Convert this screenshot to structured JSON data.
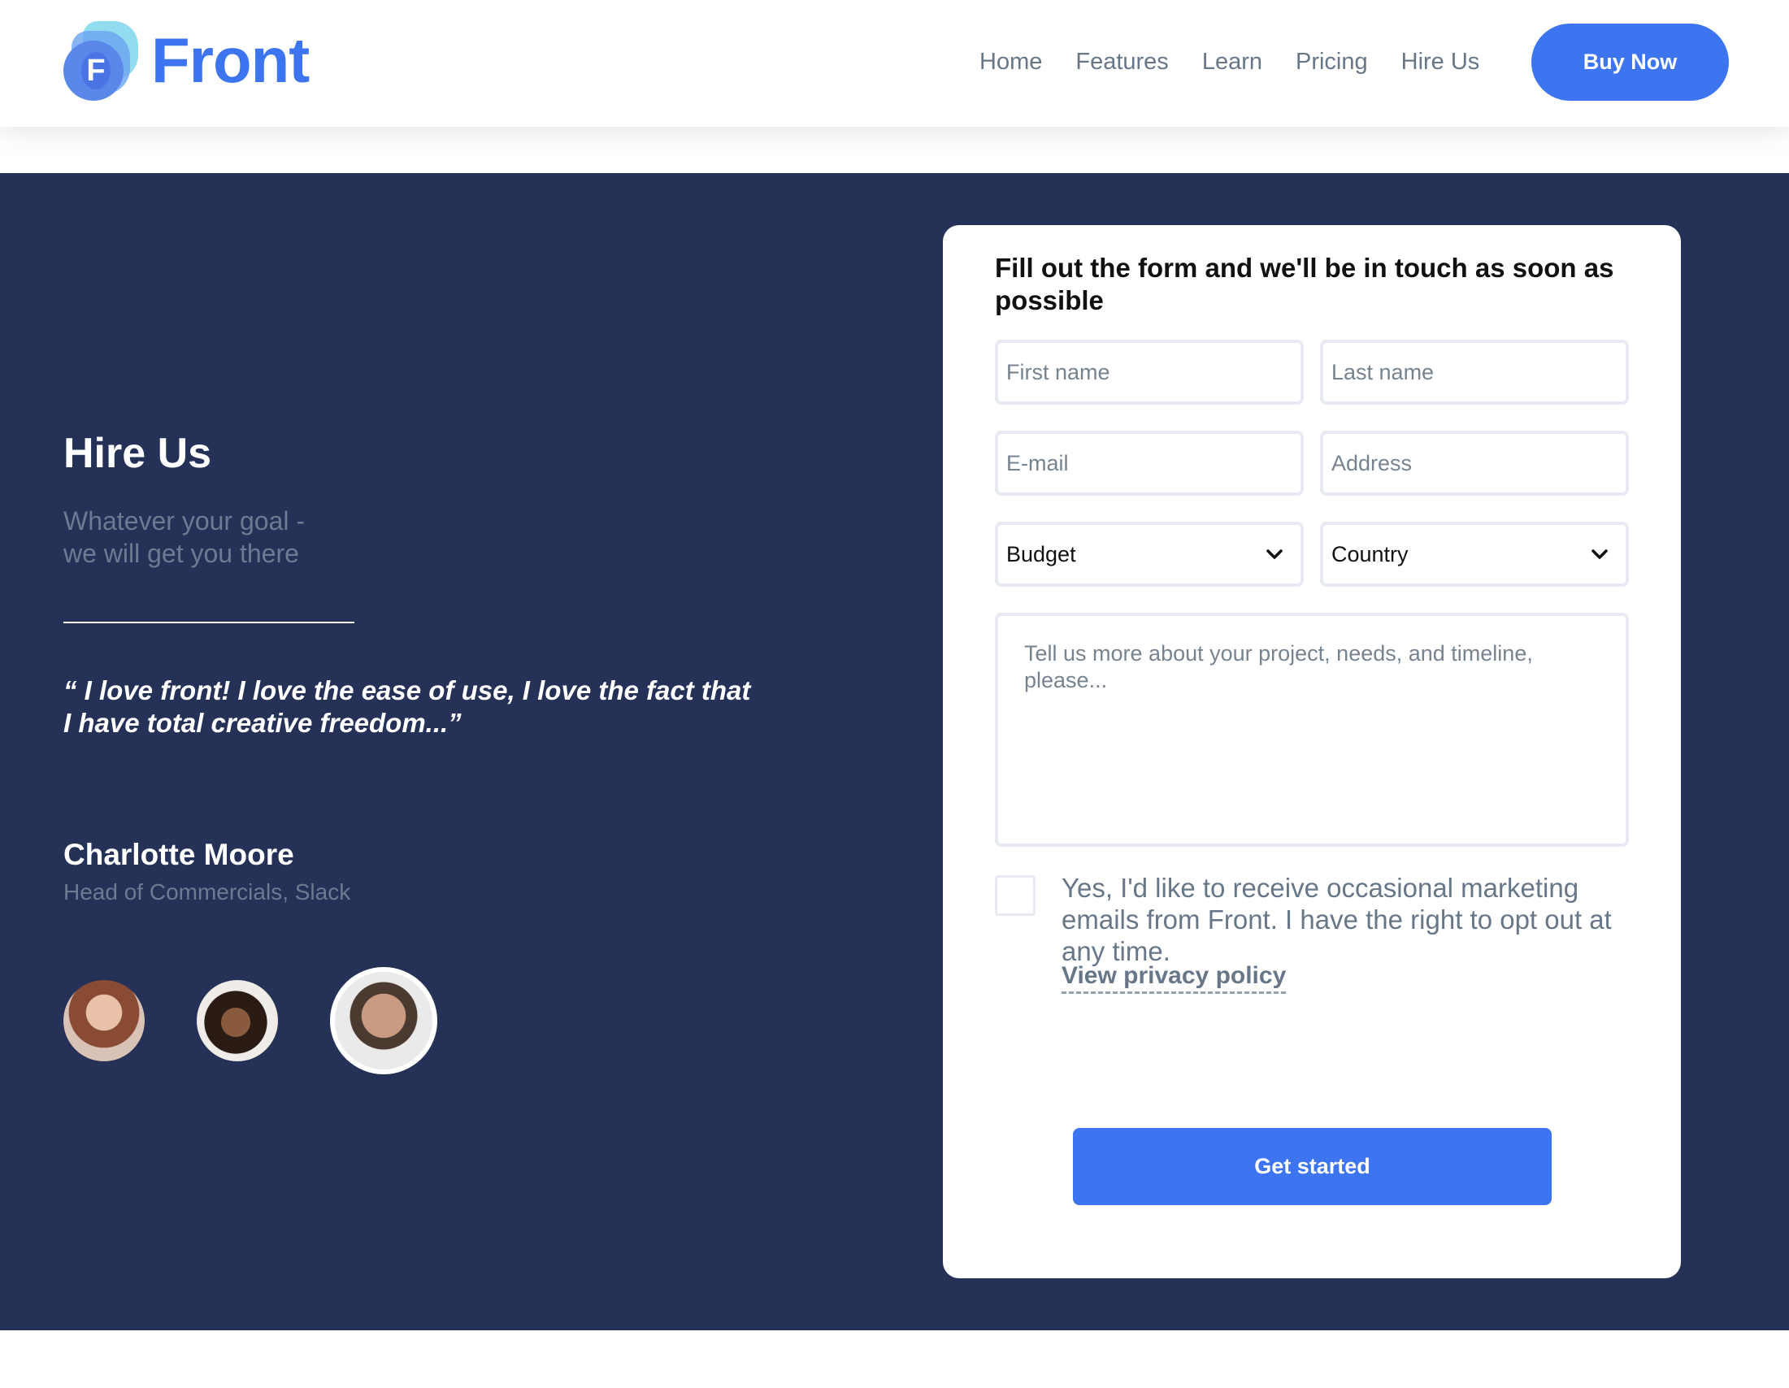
{
  "header": {
    "brand": "Front",
    "brand_mark": "F",
    "nav": [
      "Home",
      "Features",
      "Learn",
      "Pricing",
      "Hire Us"
    ],
    "buy_label": "Buy Now"
  },
  "hero": {
    "title": "Hire Us",
    "subtitle_line1": "Whatever your goal -",
    "subtitle_line2": "we will get you there",
    "quote_line1": "“ I love front! I love the ease of use, I love the fact that",
    "quote_line2": "I have total creative freedom...”",
    "person_name": "Charlotte Moore",
    "person_role": "Head of Commercials, Slack"
  },
  "form": {
    "title": "Fill out the form and we'll be in touch as soon as possible",
    "first_name_placeholder": "First name",
    "last_name_placeholder": "Last name",
    "email_placeholder": "E-mail",
    "address_placeholder": "Address",
    "budget_value": "Budget",
    "country_value": "Country",
    "message_placeholder": "Tell us more about your project, needs, and timeline, please...",
    "consent_text": "Yes, I'd like to receive occasional marketing emails from Front. I have the right to opt out at any time.",
    "privacy_link": "View privacy policy",
    "submit_label": "Get started"
  },
  "colors": {
    "primary": "#3d74f0",
    "hero_bg": "#253157",
    "muted_text": "#677788",
    "field_border": "#e7eaf3"
  },
  "icons": [
    "logo-icon",
    "chevron-down-icon",
    "checkbox-icon"
  ]
}
